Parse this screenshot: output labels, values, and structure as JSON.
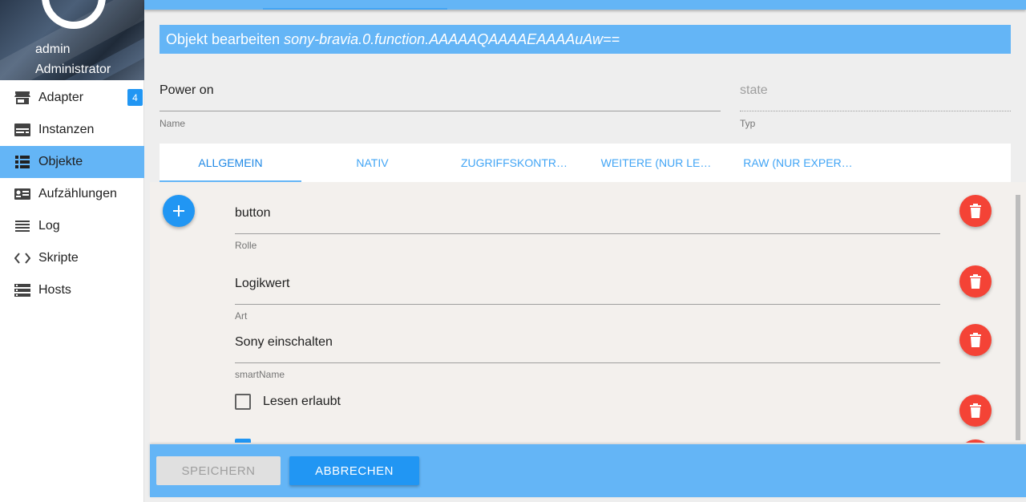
{
  "user": {
    "name": "admin",
    "role": "Administrator"
  },
  "sidebar": {
    "items": [
      {
        "label": "Adapter",
        "icon": "store-icon",
        "badge": "4"
      },
      {
        "label": "Instanzen",
        "icon": "instances-icon"
      },
      {
        "label": "Objekte",
        "icon": "list-icon",
        "active": true
      },
      {
        "label": "Aufzählungen",
        "icon": "enum-icon"
      },
      {
        "label": "Log",
        "icon": "log-icon"
      },
      {
        "label": "Skripte",
        "icon": "code-icon"
      },
      {
        "label": "Hosts",
        "icon": "hosts-icon"
      }
    ]
  },
  "dialog": {
    "title_prefix": "Objekt bearbeiten",
    "object_id": "sony-bravia.0.function.AAAAAQAAAAEAAAAuAw==",
    "name_value": "Power on",
    "name_label": "Name",
    "type_value": "state",
    "type_label": "Typ",
    "tabs": [
      {
        "label": "ALLGEMEIN",
        "active": true
      },
      {
        "label": "NATIV"
      },
      {
        "label": "ZUGRIFFSKONTR…"
      },
      {
        "label": "WEITERE (NUR LE…"
      },
      {
        "label": "RAW (NUR EXPER…"
      }
    ],
    "properties": [
      {
        "value": "button",
        "label": "Rolle"
      },
      {
        "value": "Logikwert",
        "label": "Art"
      },
      {
        "value": "Sony einschalten",
        "label": "smartName"
      }
    ],
    "checkbox_label": "Lesen erlaubt",
    "save_label": "SPEICHERN",
    "cancel_label": "ABBRECHEN"
  },
  "colors": {
    "primary": "#64b5f6",
    "accent": "#2196f3",
    "danger": "#f44336"
  }
}
